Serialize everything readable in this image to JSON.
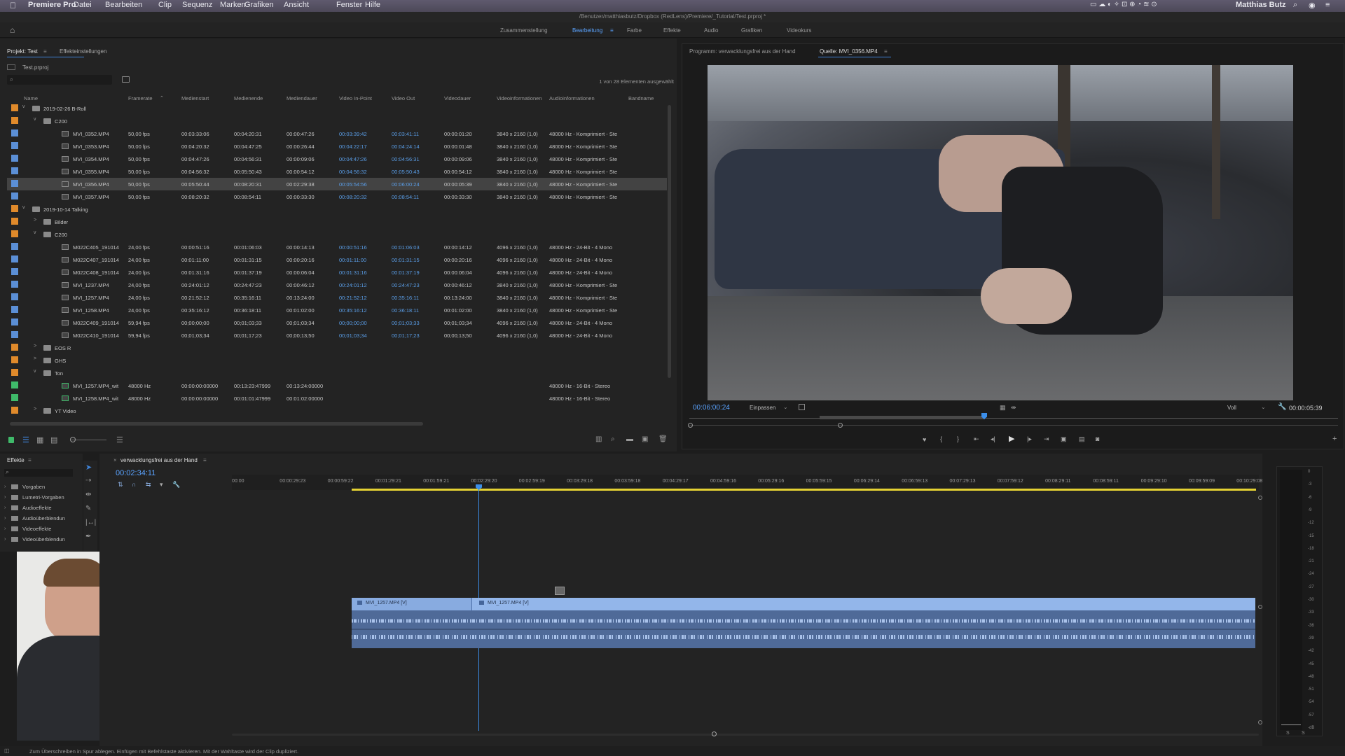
{
  "menubar": {
    "app": "Premiere Pro",
    "items": [
      "Datei",
      "Bearbeiten",
      "Clip",
      "Sequenz",
      "Marken",
      "Grafiken",
      "Ansicht",
      "Fenster",
      "Hilfe"
    ],
    "user": "Matthias Butz"
  },
  "titlebar": {
    "path": "/Benutzer/matthiasbutz/Dropbox (RedLens)/Premiere/_Tutorial/Test.prproj *"
  },
  "workspaces": {
    "tabs": [
      "Zusammenstellung",
      "Bearbeitung",
      "Farbe",
      "Effekte",
      "Audio",
      "Grafiken",
      "Videokurs"
    ],
    "active": "Bearbeitung"
  },
  "project": {
    "tab_project": "Projekt: Test",
    "tab_effects_settings": "Effekteinstellungen",
    "file": "Test.prproj",
    "selection_info": "1 von 28 Elementen ausgewählt",
    "columns": [
      "Name",
      "Framerate",
      "Medienstart",
      "Medienende",
      "Mediendauer",
      "Video In-Point",
      "Video Out",
      "Videodauer",
      "Videoinformationen",
      "Audioinformationen",
      "Bandname"
    ],
    "rows": [
      {
        "type": "folder",
        "indent": 0,
        "open": "v",
        "label_color": "#e08a2b",
        "name": "2019-02-26 B-Roll",
        "cells": [
          "",
          "",
          "",
          "",
          "",
          "",
          "",
          "",
          "",
          ""
        ]
      },
      {
        "type": "folder",
        "indent": 1,
        "open": "v",
        "label_color": "#e08a2b",
        "name": "C200",
        "cells": [
          "",
          "",
          "",
          "",
          "",
          "",
          "",
          "",
          "",
          ""
        ]
      },
      {
        "type": "clip",
        "indent": 2,
        "label_color": "#5b8fd6",
        "name": "MVI_0352.MP4",
        "cells": [
          "50,00 fps",
          "00:03:33:06",
          "00:04:20:31",
          "00:00:47:26",
          "00:03:39:42",
          "00:03:41:11",
          "00:00:01:20",
          "3840 x 2160 (1,0)",
          "48000 Hz - Komprimiert - Ste",
          ""
        ]
      },
      {
        "type": "clip",
        "indent": 2,
        "label_color": "#5b8fd6",
        "name": "MVI_0353.MP4",
        "cells": [
          "50,00 fps",
          "00:04:20:32",
          "00:04:47:25",
          "00:00:26:44",
          "00:04:22:17",
          "00:04:24:14",
          "00:00:01:48",
          "3840 x 2160 (1,0)",
          "48000 Hz - Komprimiert - Ste",
          ""
        ]
      },
      {
        "type": "clip",
        "indent": 2,
        "label_color": "#5b8fd6",
        "name": "MVI_0354.MP4",
        "cells": [
          "50,00 fps",
          "00:04:47:26",
          "00:04:56:31",
          "00:00:09:06",
          "00:04:47:26",
          "00:04:56:31",
          "00:00:09:06",
          "3840 x 2160 (1,0)",
          "48000 Hz - Komprimiert - Ste",
          ""
        ]
      },
      {
        "type": "clip",
        "indent": 2,
        "label_color": "#5b8fd6",
        "name": "MVI_0355.MP4",
        "cells": [
          "50,00 fps",
          "00:04:56:32",
          "00:05:50:43",
          "00:00:54:12",
          "00:04:56:32",
          "00:05:50:43",
          "00:00:54:12",
          "3840 x 2160 (1,0)",
          "48000 Hz - Komprimiert - Ste",
          ""
        ]
      },
      {
        "type": "clip",
        "indent": 2,
        "label_color": "#5b8fd6",
        "name": "MVI_0356.MP4",
        "selected": true,
        "cells": [
          "50,00 fps",
          "00:05:50:44",
          "00:08:20:31",
          "00:02:29:38",
          "00:05:54:56",
          "00:06:00:24",
          "00:00:05:39",
          "3840 x 2160 (1,0)",
          "48000 Hz - Komprimiert - Ste",
          ""
        ]
      },
      {
        "type": "clip",
        "indent": 2,
        "label_color": "#5b8fd6",
        "name": "MVI_0357.MP4",
        "cells": [
          "50,00 fps",
          "00:08:20:32",
          "00:08:54:11",
          "00:00:33:30",
          "00:08:20:32",
          "00:08:54:11",
          "00:00:33:30",
          "3840 x 2160 (1,0)",
          "48000 Hz - Komprimiert - Ste",
          ""
        ]
      },
      {
        "type": "folder",
        "indent": 0,
        "open": "v",
        "label_color": "#e08a2b",
        "name": "2019-10-14 Talking",
        "cells": [
          "",
          "",
          "",
          "",
          "",
          "",
          "",
          "",
          "",
          ""
        ]
      },
      {
        "type": "folder",
        "indent": 1,
        "open": ">",
        "label_color": "#e08a2b",
        "name": "Bilder",
        "cells": [
          "",
          "",
          "",
          "",
          "",
          "",
          "",
          "",
          "",
          ""
        ]
      },
      {
        "type": "folder",
        "indent": 1,
        "open": "v",
        "label_color": "#e08a2b",
        "name": "C200",
        "cells": [
          "",
          "",
          "",
          "",
          "",
          "",
          "",
          "",
          "",
          ""
        ]
      },
      {
        "type": "clip",
        "indent": 2,
        "label_color": "#5b8fd6",
        "name": "M022C405_191014",
        "cells": [
          "24,00 fps",
          "00:00:51:16",
          "00:01:06:03",
          "00:00:14:13",
          "00:00:51:16",
          "00:01:06:03",
          "00:00:14:12",
          "4096 x 2160 (1,0)",
          "48000 Hz - 24-Bit - 4 Mono",
          ""
        ]
      },
      {
        "type": "clip",
        "indent": 2,
        "label_color": "#5b8fd6",
        "name": "M022C407_191014",
        "cells": [
          "24,00 fps",
          "00:01:11:00",
          "00:01:31:15",
          "00:00:20:16",
          "00:01:11:00",
          "00:01:31:15",
          "00:00:20:16",
          "4096 x 2160 (1,0)",
          "48000 Hz - 24-Bit - 4 Mono",
          ""
        ]
      },
      {
        "type": "clip",
        "indent": 2,
        "label_color": "#5b8fd6",
        "name": "M022C408_191014",
        "cells": [
          "24,00 fps",
          "00:01:31:16",
          "00:01:37:19",
          "00:00:06:04",
          "00:01:31:16",
          "00:01:37:19",
          "00:00:06:04",
          "4096 x 2160 (1,0)",
          "48000 Hz - 24-Bit - 4 Mono",
          ""
        ]
      },
      {
        "type": "clip",
        "indent": 2,
        "label_color": "#5b8fd6",
        "name": "MVI_1237.MP4",
        "cells": [
          "24,00 fps",
          "00:24:01:12",
          "00:24:47:23",
          "00:00:46:12",
          "00:24:01:12",
          "00:24:47:23",
          "00:00:46:12",
          "3840 x 2160 (1,0)",
          "48000 Hz - Komprimiert - Ste",
          ""
        ]
      },
      {
        "type": "clip",
        "indent": 2,
        "label_color": "#5b8fd6",
        "name": "MVI_1257.MP4",
        "cells": [
          "24,00 fps",
          "00:21:52:12",
          "00:35:16:11",
          "00:13:24:00",
          "00:21:52:12",
          "00:35:16:11",
          "00:13:24:00",
          "3840 x 2160 (1,0)",
          "48000 Hz - Komprimiert - Ste",
          ""
        ]
      },
      {
        "type": "clip",
        "indent": 2,
        "label_color": "#5b8fd6",
        "name": "MVI_1258.MP4",
        "cells": [
          "24,00 fps",
          "00:35:16:12",
          "00:36:18:11",
          "00:01:02:00",
          "00:35:16:12",
          "00:36:18:11",
          "00:01:02:00",
          "3840 x 2160 (1,0)",
          "48000 Hz - Komprimiert - Ste",
          ""
        ]
      },
      {
        "type": "clip",
        "indent": 2,
        "label_color": "#5b8fd6",
        "name": "M022C409_191014",
        "cells": [
          "59,94 fps",
          "00;00;00;00",
          "00;01;03;33",
          "00;01;03;34",
          "00;00;00;00",
          "00;01;03;33",
          "00;01;03;34",
          "4096 x 2160 (1,0)",
          "48000 Hz - 24-Bit - 4 Mono",
          ""
        ]
      },
      {
        "type": "clip",
        "indent": 2,
        "label_color": "#5b8fd6",
        "name": "M022C410_191014",
        "cells": [
          "59,94 fps",
          "00;01;03;34",
          "00;01;17;23",
          "00;00;13;50",
          "00;01;03;34",
          "00;01;17;23",
          "00;00;13;50",
          "4096 x 2160 (1,0)",
          "48000 Hz - 24-Bit - 4 Mono",
          ""
        ]
      },
      {
        "type": "folder",
        "indent": 1,
        "open": ">",
        "label_color": "#e08a2b",
        "name": "EOS R",
        "cells": [
          "",
          "",
          "",
          "",
          "",
          "",
          "",
          "",
          "",
          ""
        ]
      },
      {
        "type": "folder",
        "indent": 1,
        "open": ">",
        "label_color": "#e08a2b",
        "name": "GHS",
        "cells": [
          "",
          "",
          "",
          "",
          "",
          "",
          "",
          "",
          "",
          ""
        ]
      },
      {
        "type": "folder",
        "indent": 1,
        "open": "v",
        "label_color": "#e08a2b",
        "name": "Ton",
        "cells": [
          "",
          "",
          "",
          "",
          "",
          "",
          "",
          "",
          "",
          ""
        ]
      },
      {
        "type": "audio",
        "indent": 2,
        "label_color": "#3fba6a",
        "name": "MVI_1257.MP4_wit",
        "cells": [
          "48000  Hz",
          "00:00:00:00000",
          "00:13:23:47999",
          "00:13:24:00000",
          "",
          "",
          "",
          "",
          "48000 Hz - 16-Bit - Stereo",
          ""
        ]
      },
      {
        "type": "audio",
        "indent": 2,
        "label_color": "#3fba6a",
        "name": "MVI_1258.MP4_wit",
        "cells": [
          "48000  Hz",
          "00:00:00:00000",
          "00:01:01:47999",
          "00:01:02:00000",
          "",
          "",
          "",
          "",
          "48000 Hz - 16-Bit - Stereo",
          ""
        ]
      },
      {
        "type": "folder",
        "indent": 1,
        "open": ">",
        "label_color": "#e08a2b",
        "name": "YT Video",
        "cells": [
          "",
          "",
          "",
          "",
          "",
          "",
          "",
          "",
          "",
          ""
        ]
      }
    ]
  },
  "program": {
    "tab_program": "Programm: verwacklungsfrei aus der Hand",
    "tab_source": "Quelle: MVI_0356.MP4",
    "timecode": "00:06:00:24",
    "fit": "Einpassen",
    "quality": "Voll",
    "duration": "00:00:05:39"
  },
  "effects": {
    "tab": "Effekte",
    "items": [
      "Vorgaben",
      "Lumetri-Vorgaben",
      "Audioeffekte",
      "Audioüberblendun",
      "Videoeffekte",
      "Videoüberblendun"
    ]
  },
  "timeline": {
    "sequence": "verwacklungsfrei aus der Hand",
    "timecode": "00:02:34:11",
    "ruler": [
      "00:00",
      "00:00:29:23",
      "00:00:59:22",
      "00:01:29:21",
      "00:01:59:21",
      "00:02:29:20",
      "00:02:59:19",
      "00:03:29:18",
      "00:03:59:18",
      "00:04:29:17",
      "00:04:59:16",
      "00:05:29:16",
      "00:05:59:15",
      "00:06:29:14",
      "00:06:59:13",
      "00:07:29:13",
      "00:07:59:12",
      "00:08:29:11",
      "00:08:59:11",
      "00:09:29:10",
      "00:09:59:09",
      "00:10:29:08"
    ],
    "clips": [
      "MVI_1257.MP4 [V]",
      "MVI_1257.MP4 [V]"
    ],
    "meter_scale": [
      "0",
      "-3",
      "-6",
      "-9",
      "-12",
      "-15",
      "-18",
      "-21",
      "-24",
      "-27",
      "-30",
      "-33",
      "-36",
      "-39",
      "-42",
      "-45",
      "-48",
      "-51",
      "-54",
      "-57",
      "-dB"
    ],
    "meter_footer": [
      "S",
      "S"
    ]
  },
  "status": {
    "text": "Zum Überschreiben in Spur ablegen. Einfügen mit Befehlstaste aktivieren. Mit der Wahltaste wird der Clip dupliziert."
  },
  "colors": {
    "accent": "#3b8eea",
    "playhead": "#3b8eea",
    "clip": "#93b6ea",
    "work_area": "#e5d233"
  }
}
